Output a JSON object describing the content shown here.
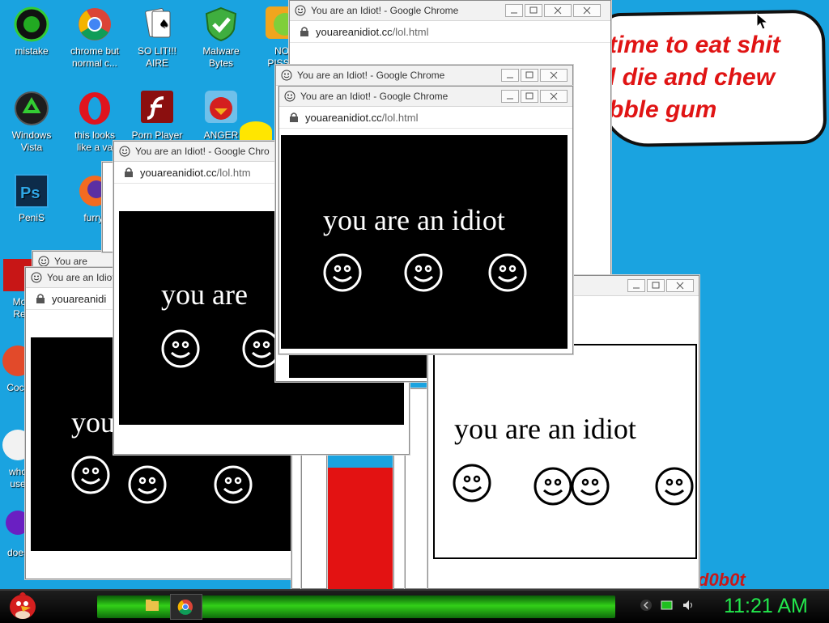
{
  "desktop": {
    "speech_lines": [
      "time to eat shit",
      "l die and chew",
      "bble gum"
    ],
    "signature": "d0b0t",
    "icons": [
      {
        "label1": "mistake",
        "label2": "",
        "icon": "mistake-icon"
      },
      {
        "label1": "chrome but",
        "label2": "normal c...",
        "icon": "chrome-icon"
      },
      {
        "label1": "SO LIT!!!",
        "label2": "AIRE",
        "icon": "solitaire-icon"
      },
      {
        "label1": "Malware",
        "label2": "Bytes",
        "icon": "malwarebytes-icon"
      },
      {
        "label1": "NO",
        "label2": "PISSE",
        "icon": "pig-icon"
      },
      {
        "label1": "Windows",
        "label2": "Vista",
        "icon": "recycle-icon"
      },
      {
        "label1": "this looks",
        "label2": "like a va",
        "icon": "opera-icon"
      },
      {
        "label1": "Porn Player",
        "label2": "",
        "icon": "flash-icon"
      },
      {
        "label1": "ANGER",
        "label2": "",
        "icon": "angry-bird-icon"
      },
      {
        "label1": "PeniS",
        "label2": "",
        "icon": "photoshop-icon"
      },
      {
        "label1": "furryf",
        "label2": "",
        "icon": "firefox-icon"
      },
      {
        "label1": "Mo",
        "label2": "Re",
        "icon": "red-app-icon"
      },
      {
        "label1": "Cock",
        "label2": "",
        "icon": "red-circle-icon"
      },
      {
        "label1": "who",
        "label2": "use",
        "icon": "white-circle-icon"
      },
      {
        "label1": "does",
        "label2": "",
        "icon": "yahoo-icon"
      }
    ]
  },
  "window": {
    "title": "You are an Idiot! - Google Chrome",
    "title_short_1": "You are an Idiot! - Google Chro",
    "title_short_2": "You are an Idiot!",
    "title_short_3": "You are",
    "host": "youareanidiot.cc",
    "path": "/lol.html",
    "path_short": "/lol.htm",
    "host_short": "youareanidi",
    "message": "you are an idiot",
    "message_partial_1": "you are",
    "message_partial_2": "you"
  },
  "taskbar": {
    "clock": "11:21 AM",
    "items": [
      "file-explorer-icon",
      "chrome-icon"
    ],
    "tray": [
      "chevron-left-icon",
      "battery-icon",
      "volume-icon"
    ]
  },
  "colors": {
    "desktop": "#1aa3e0",
    "accent_green": "#22e84c",
    "speech_red": "#e01414"
  }
}
